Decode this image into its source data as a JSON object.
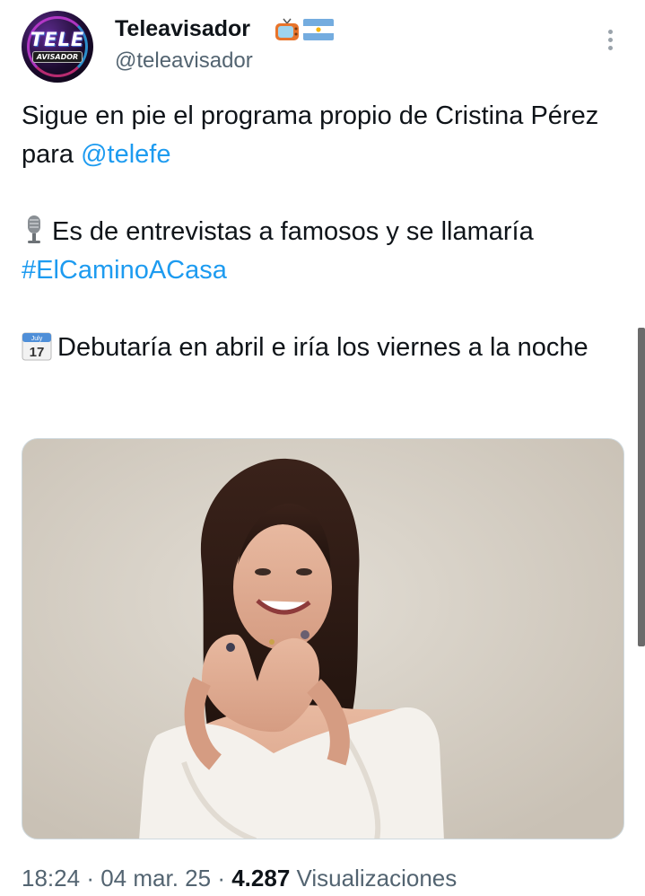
{
  "account": {
    "avatar_text": "TELE",
    "avatar_subtext": "AVISADOR",
    "display_name": "Teleavisador",
    "handle": "@teleavisador",
    "badges": [
      "tv-icon",
      "argentina-flag-icon"
    ]
  },
  "tweet": {
    "line1_text": "Sigue en pie el programa propio de Cristina Pérez para ",
    "line1_mention": "@telefe",
    "line2_emoji": "microphone-icon",
    "line2_text": "Es de entrevistas a famosos y se llamaría ",
    "line2_hashtag": "#ElCaminoACasa",
    "line3_emoji": "calendar-icon",
    "calendar_month": "July",
    "calendar_day": "17",
    "line3_text": "Debutaría en abril e iría los viernes a la noche"
  },
  "media": {
    "subject": "photo-woman-white-blouse"
  },
  "meta": {
    "time": "18:24",
    "separator": "·",
    "date": "04 mar. 25",
    "views_count": "4.287",
    "views_label": "Visualizaciones"
  },
  "colors": {
    "link": "#1d9bf0",
    "text": "#0f1419",
    "secondary": "#536471"
  }
}
